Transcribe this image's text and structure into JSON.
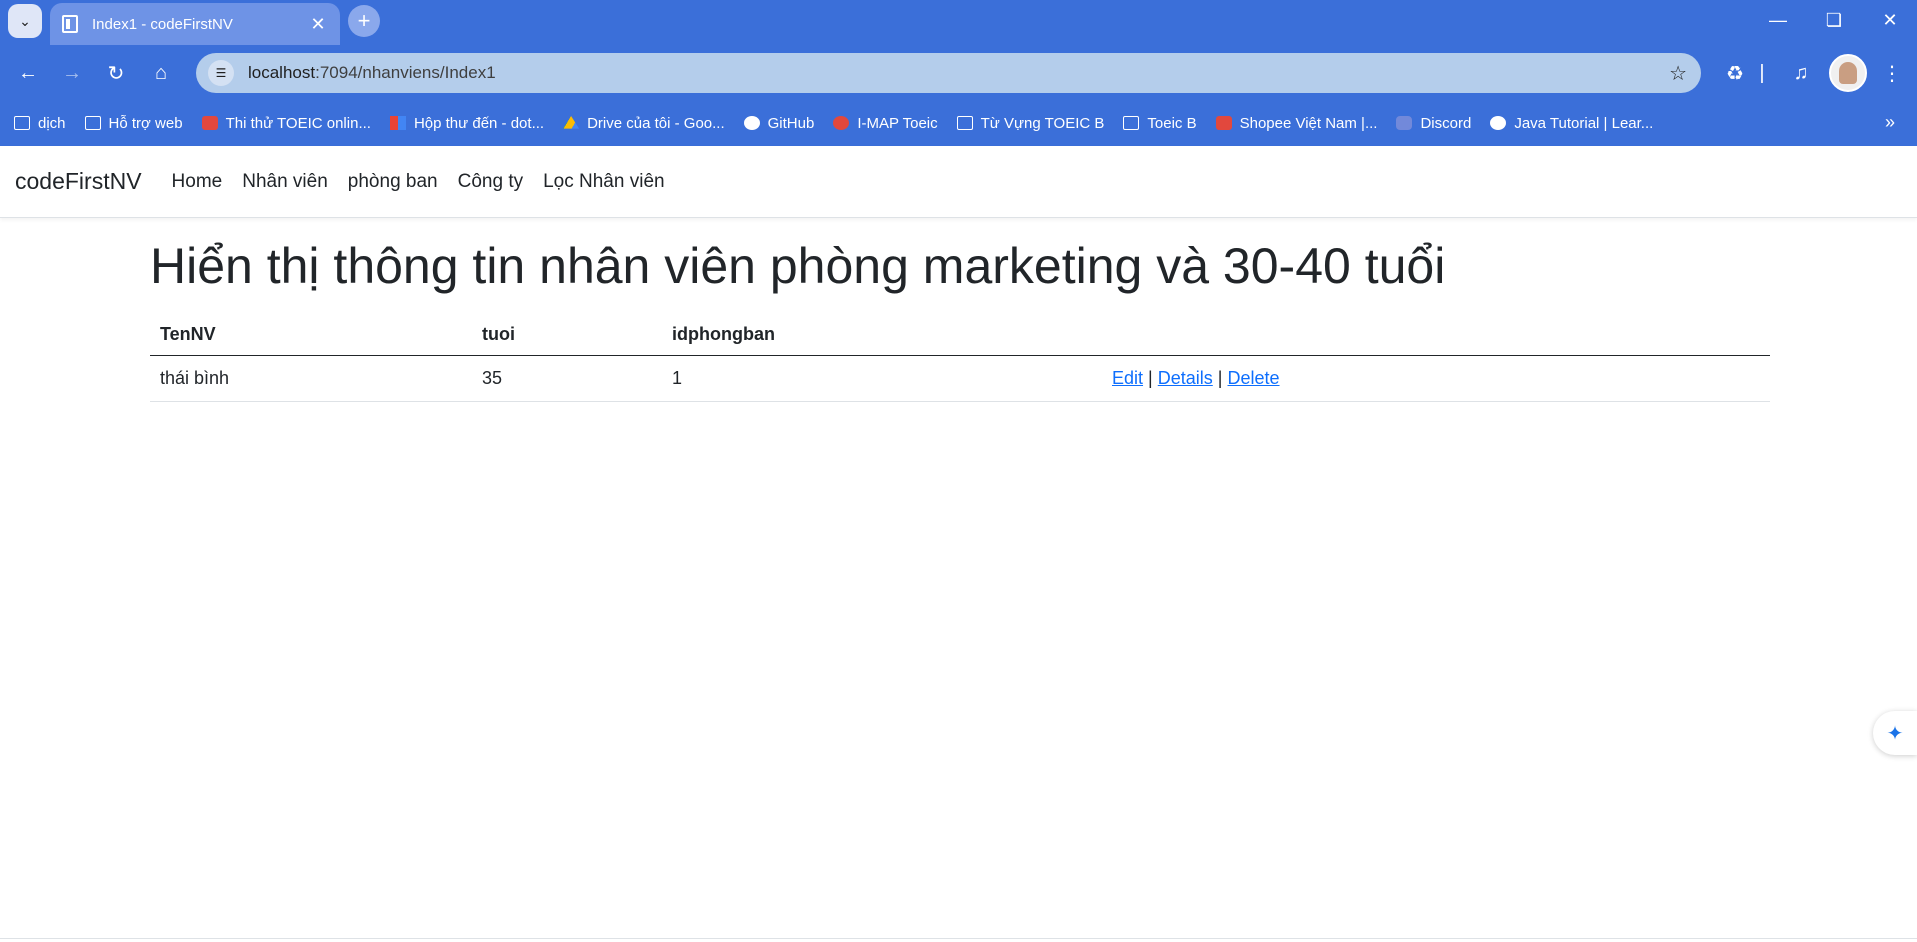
{
  "browser": {
    "tab_title": "Index1 - codeFirstNV",
    "url_host": "localhost",
    "url_path": ":7094/nhanviens/Index1",
    "bookmarks": [
      {
        "label": "dịch",
        "icon": "folder-icon"
      },
      {
        "label": "Hỗ trợ web",
        "icon": "folder-icon"
      },
      {
        "label": "Thi thử TOEIC onlin...",
        "icon": "toeic-icon"
      },
      {
        "label": "Hộp thư đến - dot...",
        "icon": "gmail-icon"
      },
      {
        "label": "Drive của tôi - Goo...",
        "icon": "drive-icon"
      },
      {
        "label": "GitHub",
        "icon": "github-icon"
      },
      {
        "label": "I-MAP Toeic",
        "icon": "imap-icon"
      },
      {
        "label": "Từ Vựng TOEIC B",
        "icon": "folder-icon"
      },
      {
        "label": "Toeic B",
        "icon": "folder-icon"
      },
      {
        "label": "Shopee Việt Nam |...",
        "icon": "shopee-icon"
      },
      {
        "label": "Discord",
        "icon": "discord-icon"
      },
      {
        "label": "Java Tutorial | Lear...",
        "icon": "globe-icon"
      }
    ]
  },
  "site": {
    "brand": "codeFirstNV",
    "nav": [
      "Home",
      "Nhân viên",
      "phòng ban",
      "Công ty",
      "Lọc Nhân viên"
    ],
    "title": "Hiển thị thông tin nhân viên phòng marketing và 30-40 tuổi",
    "table": {
      "headers": [
        "TenNV",
        "tuoi",
        "idphongban"
      ],
      "rows": [
        {
          "tennv": "thái bình",
          "tuoi": "35",
          "idphongban": "1"
        }
      ],
      "actions": {
        "edit": "Edit",
        "details": "Details",
        "delete": "Delete",
        "sep": "|"
      }
    }
  }
}
